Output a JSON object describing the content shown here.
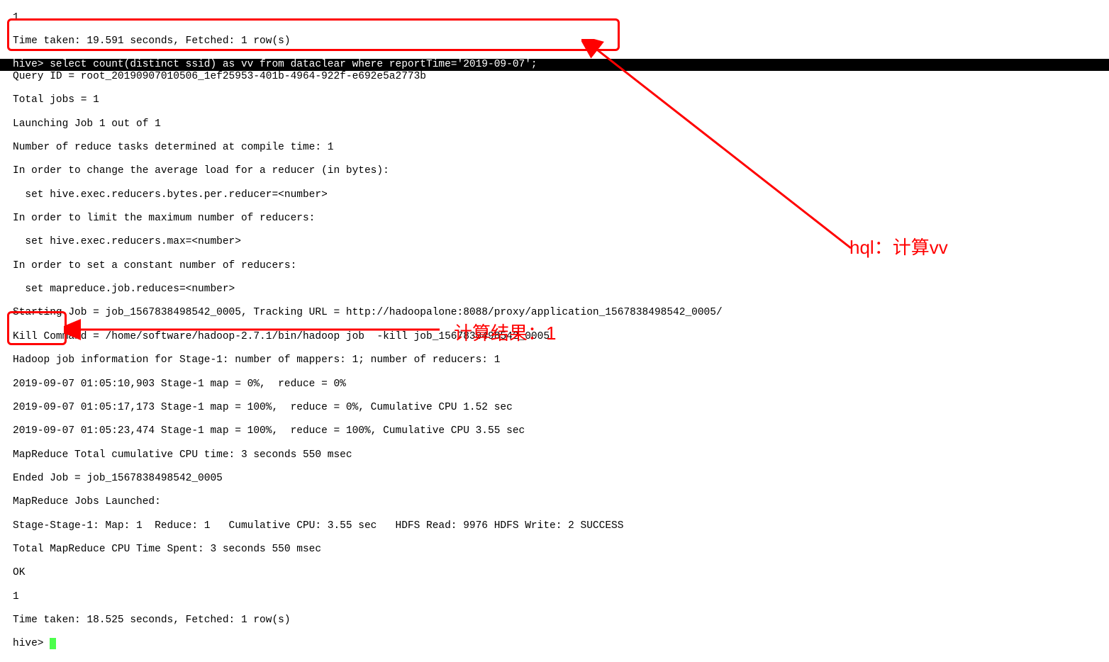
{
  "terminal": {
    "pre_lines": [
      "1",
      "Time taken: 19.591 seconds, Fetched: 1 row(s)"
    ],
    "prompt_highlight": "hive> select count(distinct ssid) as vv from dataclear where reportTime='2019-09-07';",
    "query_id_line": "Query ID = root_20190907010506_1ef25953-401b-4964-922f-e692e5a2773b",
    "body_lines": [
      "Total jobs = 1",
      "Launching Job 1 out of 1",
      "Number of reduce tasks determined at compile time: 1",
      "In order to change the average load for a reducer (in bytes):",
      "  set hive.exec.reducers.bytes.per.reducer=<number>",
      "In order to limit the maximum number of reducers:",
      "  set hive.exec.reducers.max=<number>",
      "In order to set a constant number of reducers:",
      "  set mapreduce.job.reduces=<number>",
      "Starting Job = job_1567838498542_0005, Tracking URL = http://hadoopalone:8088/proxy/application_1567838498542_0005/",
      "Kill Command = /home/software/hadoop-2.7.1/bin/hadoop job  -kill job_1567838498542_0005",
      "Hadoop job information for Stage-1: number of mappers: 1; number of reducers: 1",
      "2019-09-07 01:05:10,903 Stage-1 map = 0%,  reduce = 0%",
      "2019-09-07 01:05:17,173 Stage-1 map = 100%,  reduce = 0%, Cumulative CPU 1.52 sec",
      "2019-09-07 01:05:23,474 Stage-1 map = 100%,  reduce = 100%, Cumulative CPU 3.55 sec",
      "MapReduce Total cumulative CPU time: 3 seconds 550 msec",
      "Ended Job = job_1567838498542_0005",
      "MapReduce Jobs Launched:",
      "Stage-Stage-1: Map: 1  Reduce: 1   Cumulative CPU: 3.55 sec   HDFS Read: 9976 HDFS Write: 2 SUCCESS",
      "Total MapReduce CPU Time Spent: 3 seconds 550 msec",
      "OK",
      "1",
      "Time taken: 18.525 seconds, Fetched: 1 row(s)"
    ],
    "final_prompt": "hive> "
  },
  "annotations": {
    "top_label": "hql：计算vv",
    "bottom_label": "计算结果：1"
  }
}
